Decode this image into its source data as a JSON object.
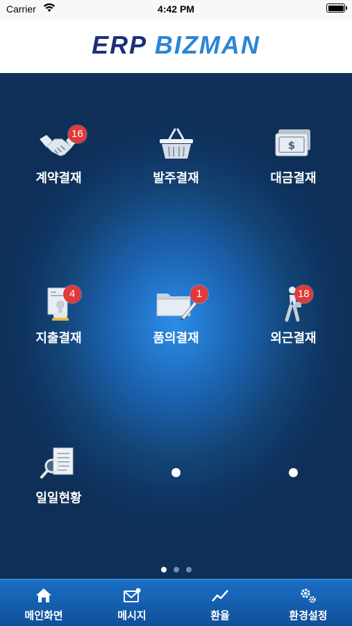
{
  "status_bar": {
    "carrier": "Carrier",
    "time": "4:42 PM"
  },
  "header": {
    "logo_part1": "ERP",
    "logo_part2": "BIZMAN"
  },
  "menu": [
    {
      "label": "계약결재",
      "badge": "16",
      "icon": "handshake-icon"
    },
    {
      "label": "발주결재",
      "badge": "",
      "icon": "basket-icon"
    },
    {
      "label": "대금결재",
      "badge": "",
      "icon": "money-icon"
    },
    {
      "label": "지출결재",
      "badge": "4",
      "icon": "stamp-document-icon"
    },
    {
      "label": "품의결재",
      "badge": "1",
      "icon": "folder-pen-icon"
    },
    {
      "label": "외근결재",
      "badge": "18",
      "icon": "walking-person-icon"
    },
    {
      "label": "일일현황",
      "badge": "",
      "icon": "document-search-icon"
    }
  ],
  "pager": {
    "pages": 3,
    "current": 1
  },
  "tabs": [
    {
      "label": "메인화면",
      "icon": "home-icon"
    },
    {
      "label": "메시지",
      "icon": "mail-icon"
    },
    {
      "label": "환율",
      "icon": "trend-line-icon"
    },
    {
      "label": "환경설정",
      "icon": "gears-icon"
    }
  ],
  "colors": {
    "accent": "#2a86d6",
    "badge": "#e23a3a",
    "background": "#0e2f57",
    "tab_bar": "#1763b5"
  }
}
